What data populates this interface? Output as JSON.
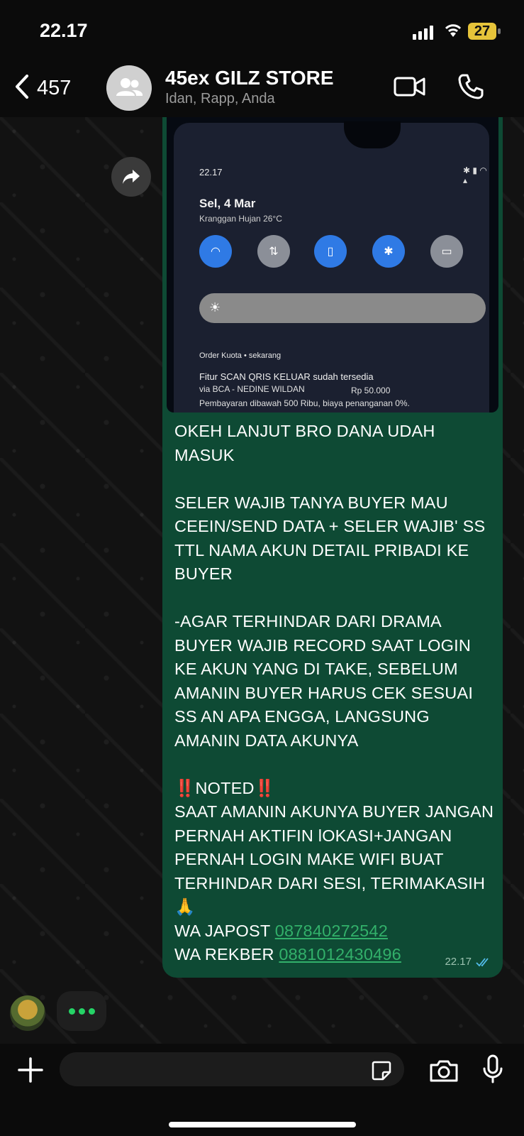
{
  "status_bar": {
    "time": "22.17",
    "battery": "27"
  },
  "header": {
    "back_count": "457",
    "title": "45ex GILZ STORE",
    "subtitle": "Idan, Rapp, Anda",
    "icons": [
      "chevron-left-icon",
      "group-icon",
      "video-call-icon",
      "phone-icon"
    ]
  },
  "message": {
    "photo": {
      "time": "22.17",
      "date": "Sel, 4 Mar",
      "weather": "Kranggan Hujan 26°C",
      "notif_app": "Order Kuota • sekarang",
      "notif_title": "Fitur SCAN QRIS KELUAR sudah tersedia",
      "notif_line2": "via BCA - NEDINE WILDAN",
      "notif_amount": "Rp 50.000",
      "notif_line3": "Pembayaran dibawah 500 Ribu, biaya penanganan 0%."
    },
    "text": "OKEH LANJUT BRO DANA UDAH MASUK\n\nSELER WAJIB TANYA BUYER MAU CEEIN/SEND DATA + SELER WAJIB' SS TTL NAMA AKUN DETAIL PRIBADI KE BUYER\n\n-AGAR TERHINDAR DARI DRAMA BUYER WAJIB RECORD SAAT LOGIN KE AKUN YANG DI TAKE, SEBELUM AMANIN BUYER HARUS CEK SESUAI SS AN APA ENGGA, LANGSUNG AMANIN DATA AKUNYA\n\n‼️NOTED‼️\nSAAT AMANIN AKUNYA BUYER JANGAN PERNAH AKTIFIN lOKASI+JANGAN PERNAH LOGIN MAKE WIFI BUAT TERHINDAR DARI SESI, TERIMAKASIH 🙏",
    "line_japost_label": "WA JAPOST ",
    "line_japost_number": "087840272542",
    "line_rekber_label": "WA REKBER ",
    "line_rekber_number": "0881012430496",
    "time": "22.17",
    "status_icon": "double-check-icon"
  },
  "composer": {
    "placeholder": "",
    "icons": [
      "plus-icon",
      "sticker-icon",
      "camera-icon",
      "microphone-icon"
    ]
  },
  "colors": {
    "bubble": "#0e4a34",
    "link": "#32b06a",
    "typing_dot": "#25d366",
    "battery": "#e6c43a"
  }
}
